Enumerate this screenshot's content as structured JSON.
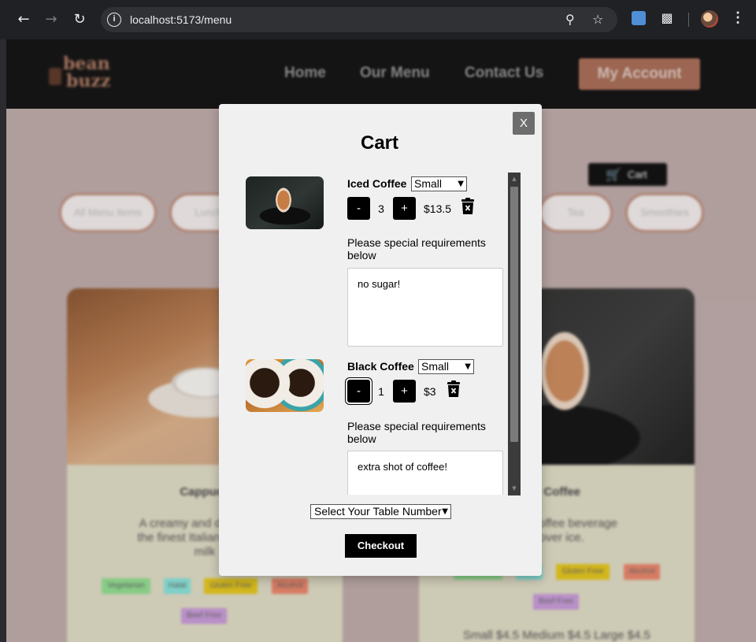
{
  "browser": {
    "url": "localhost:5173/menu",
    "back_icon": "arrow-left-icon",
    "forward_icon": "arrow-right-icon",
    "reload_icon": "reload-icon"
  },
  "site": {
    "logo_text_1": "bean",
    "logo_text_2": "buzz",
    "nav": [
      "Home",
      "Our Menu",
      "Contact Us"
    ],
    "account_button": "My Account",
    "cart_button": "Cart",
    "filters": [
      "All Menu Items",
      "Lunch",
      "Tea",
      "Smoothies"
    ],
    "cards": [
      {
        "title": "Cappucc",
        "description": "A creamy and delicious b\nthe finest Italian coffee be\nmilk",
        "tags": [
          "Vegetarian",
          "Halal",
          "Gluten Free",
          "Alcohol",
          "Beef Free"
        ]
      },
      {
        "title": "d Coffee",
        "description": "chilled coffee beverage\nd over ice.",
        "tags": [
          "Vegetarian",
          "Halal",
          "Gluten Free",
          "Alcohol",
          "Beef Free"
        ],
        "price": "Small $4.5 Medium $4.5 Large $4.5"
      }
    ]
  },
  "cart": {
    "title": "Cart",
    "close_label": "X",
    "items": [
      {
        "name": "Iced Coffee",
        "size": "Small",
        "minus": "-",
        "plus": "+",
        "quantity": "3",
        "price": "$13.5",
        "request_label": "Please special requirements below",
        "request_text": "no sugar!"
      },
      {
        "name": "Black Coffee",
        "size": "Small",
        "minus": "-",
        "plus": "+",
        "quantity": "1",
        "price": "$3",
        "request_label": "Please special requirements below",
        "request_text": "extra shot of coffee!"
      }
    ],
    "table_select": "Select Your Table Number",
    "checkout_label": "Checkout"
  },
  "colors": {
    "brand": "#a76d58",
    "modal_bg": "#f0f0f0",
    "page_bg": "#bcaaa9"
  }
}
